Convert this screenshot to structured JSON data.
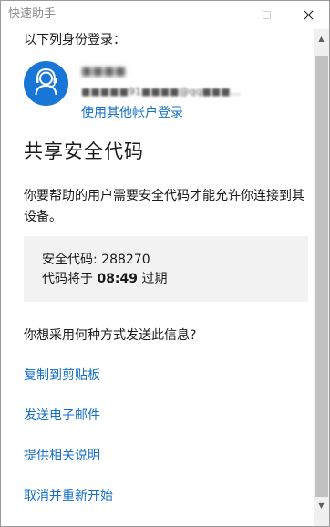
{
  "window": {
    "title": "快速助手"
  },
  "account": {
    "signed_in_label": "以下列身份登录：",
    "name": "■■■■",
    "email": "■■■■■91■■■■@qq■■■…",
    "switch_account_label": "使用其他帐户登录",
    "avatar_color": "#1877d6"
  },
  "security_code": {
    "title": "共享安全代码",
    "description": "你要帮助的用户需要安全代码才能允许你连接到其设备。",
    "code_label": "安全代码: ",
    "code": "288270",
    "expires_prefix": "代码将于 ",
    "expires_time": "08:49",
    "expires_suffix": " 过期"
  },
  "send": {
    "question": "你想采用何种方式发送此信息?",
    "options": [
      "复制到剪贴板",
      "发送电子邮件",
      "提供相关说明",
      "取消并重新开始"
    ]
  },
  "colors": {
    "link": "#1470c8",
    "code_box_bg": "#f2f2f2"
  }
}
